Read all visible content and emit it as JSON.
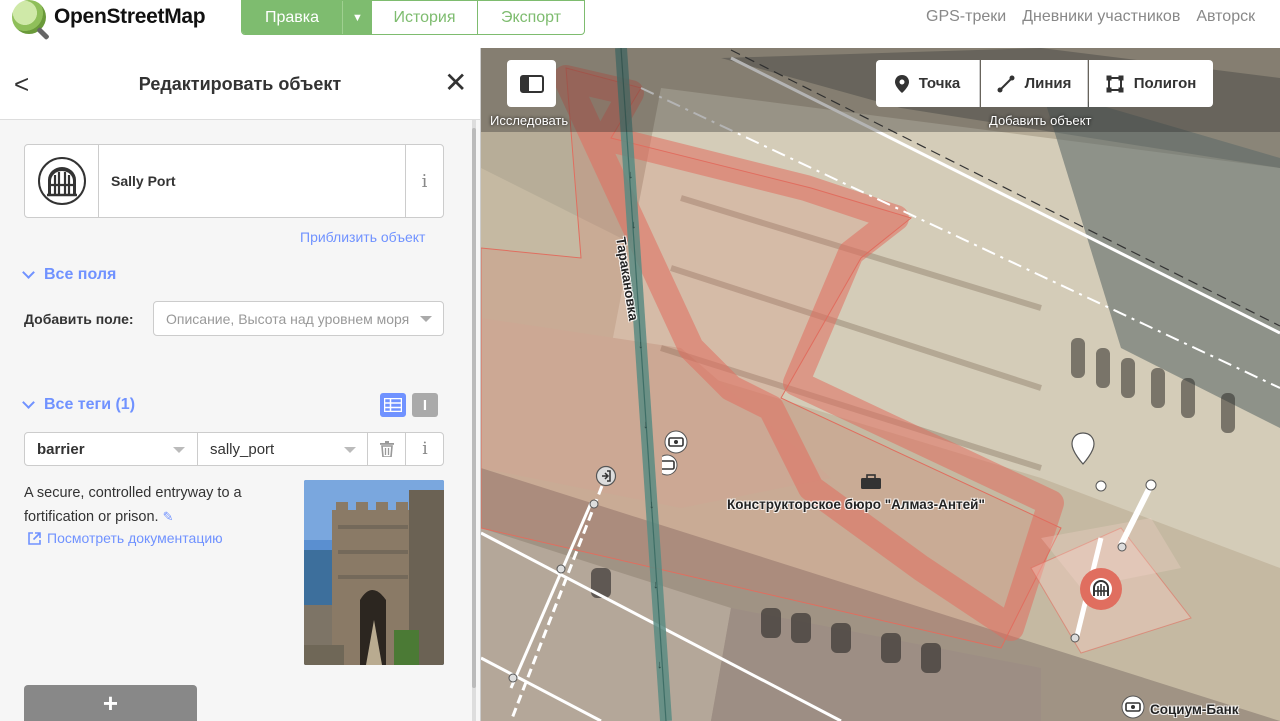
{
  "app": {
    "name": "OpenStreetMap",
    "nav": {
      "edit": "Правка",
      "history": "История",
      "export": "Экспорт",
      "links": [
        "GPS-треки",
        "Дневники участников",
        "Авторск"
      ]
    }
  },
  "sidebar": {
    "title": "Редактировать объект",
    "preset": {
      "name": "Sally Port",
      "icon": "sally-port-icon"
    },
    "zoom_link": "Приблизить объект",
    "all_fields": {
      "heading": "Все поля",
      "add_field_label": "Добавить поле:",
      "add_field_placeholder": "Описание, Высота над уровнем моря"
    },
    "all_tags": {
      "heading": "Все теги (1)",
      "tags": [
        {
          "key": "barrier",
          "value": "sally_port"
        }
      ]
    },
    "docs": {
      "description": "A secure, controlled entryway to a fortification or prison.",
      "link": "Посмотреть документацию"
    }
  },
  "map": {
    "tools": {
      "inspect_label": "Исследовать",
      "point": "Точка",
      "line": "Линия",
      "area": "Полигон",
      "add_label": "Добавить объект"
    },
    "labels": {
      "street": "Таракановка",
      "building": "Конструкторское бюро \"Алмаз-Антей\"",
      "bank": "Социум-Банк"
    },
    "colors": {
      "building_outline": "#e06e5f",
      "selected_vertex": "#e06e5f",
      "street_stroke": "#5b8c83"
    }
  }
}
